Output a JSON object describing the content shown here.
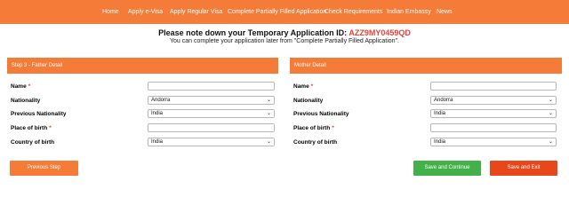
{
  "nav": {
    "items": [
      "Home",
      "Apply e-Visa",
      "Apply Regular Visa",
      "Complete Partially Filled Application",
      "Check Requirements",
      "Indian Embassy",
      "News"
    ]
  },
  "notice": {
    "prefix": "Please note down your Temporary Application ID:",
    "app_id": "AZZ9MY0459QD",
    "subtext": "You can complete your application later from \"Complete Partially Filled Application\"."
  },
  "father_panel": {
    "title": "Step 3 - Father Detail",
    "fields": [
      {
        "label": "Name",
        "required": "*",
        "value": ""
      },
      {
        "label": "Nationality",
        "required": "",
        "value": "Andorra"
      },
      {
        "label": "Previous Nationality",
        "required": "",
        "value": "India"
      },
      {
        "label": "Place of birth",
        "required": "*",
        "value": ""
      },
      {
        "label": "Country of birth",
        "required": "",
        "value": "India"
      }
    ]
  },
  "mother_panel": {
    "title": "Mother Detail",
    "fields": [
      {
        "label": "Name",
        "required": "*",
        "value": ""
      },
      {
        "label": "Nationality",
        "required": "",
        "value": "Andorra"
      },
      {
        "label": "Previous Nationality",
        "required": "",
        "value": "India"
      },
      {
        "label": "Place of birth",
        "required": "*",
        "value": ""
      },
      {
        "label": "Country of birth",
        "required": "",
        "value": "India"
      }
    ]
  },
  "buttons": {
    "previous": "Previous Step",
    "save_continue": "Save and Continue",
    "save_exit": "Save and Exit"
  },
  "colors": {
    "brand_orange": "#f47b38",
    "id_red": "#e8413a",
    "save_green": "#43b049",
    "exit_red": "#e8461b"
  },
  "icons": {
    "select": "chevron-down-icon"
  }
}
